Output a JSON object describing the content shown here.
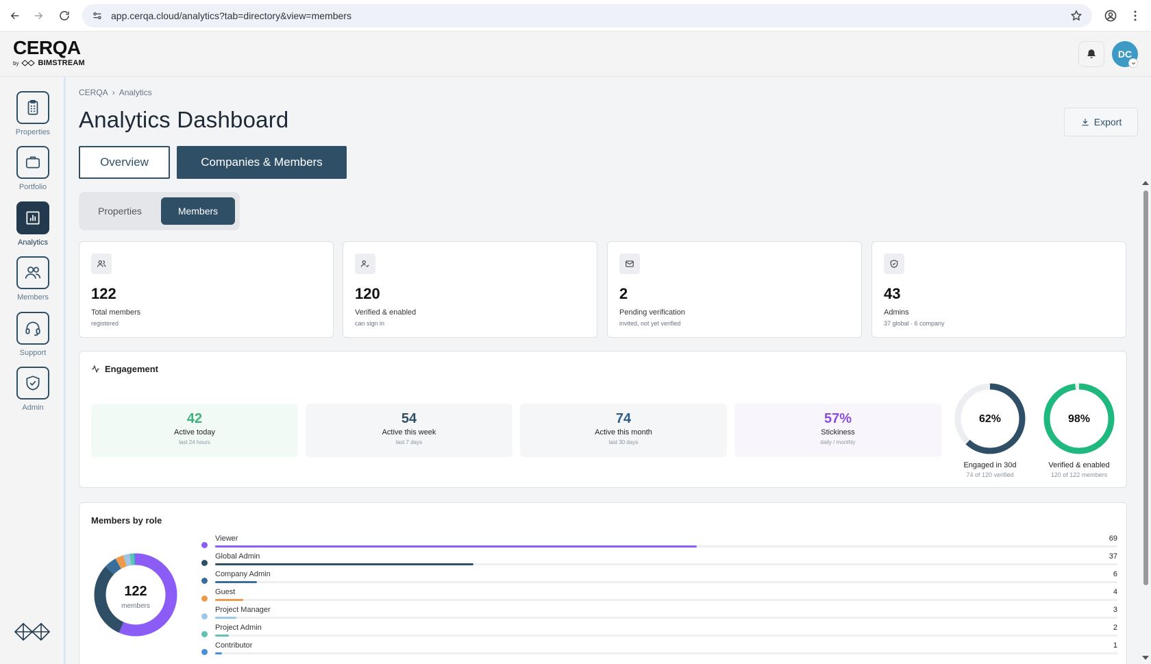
{
  "browser": {
    "url": "app.cerqa.cloud/analytics?tab=directory&view=members"
  },
  "header": {
    "logo": "CERQA",
    "logo_by": "by",
    "logo_sub": "BIMSTREAM",
    "avatar_initials": "DC"
  },
  "sidebar": {
    "items": [
      {
        "label": "Properties",
        "icon": "clipboard-icon"
      },
      {
        "label": "Portfolio",
        "icon": "briefcase-icon"
      },
      {
        "label": "Analytics",
        "icon": "bar-chart-icon",
        "active": true
      },
      {
        "label": "Members",
        "icon": "users-icon"
      },
      {
        "label": "Support",
        "icon": "headset-icon"
      },
      {
        "label": "Admin",
        "icon": "shield-check-icon"
      }
    ]
  },
  "breadcrumb": {
    "root": "CERQA",
    "separator": "›",
    "current": "Analytics"
  },
  "page": {
    "title": "Analytics Dashboard",
    "export_label": "Export"
  },
  "tabs": {
    "overview": "Overview",
    "companies_members": "Companies & Members"
  },
  "subtabs": {
    "properties": "Properties",
    "members": "Members"
  },
  "stats": [
    {
      "value": "122",
      "label": "Total members",
      "sub": "registered",
      "icon": "users-icon"
    },
    {
      "value": "120",
      "label": "Verified & enabled",
      "sub": "can sign in",
      "icon": "user-check-icon"
    },
    {
      "value": "2",
      "label": "Pending verification",
      "sub": "invited, not yet verified",
      "icon": "mail-icon"
    },
    {
      "value": "43",
      "label": "Admins",
      "sub": "37 global · 6 company",
      "icon": "shield-icon"
    }
  ],
  "engagement": {
    "title": "Engagement",
    "boxes": [
      {
        "value": "42",
        "label": "Active today",
        "sub": "last 24 hours",
        "color": "#3bb27a",
        "bg": "#f2faf6"
      },
      {
        "value": "54",
        "label": "Active this week",
        "sub": "last 7 days",
        "color": "#2f4f67",
        "bg": "#f4f6f8"
      },
      {
        "value": "74",
        "label": "Active this month",
        "sub": "last 30 days",
        "color": "#2f5e85",
        "bg": "#f4f6f8"
      },
      {
        "value": "57%",
        "label": "Stickiness",
        "sub": "daily / monthly",
        "color": "#8a4fd8",
        "bg": "#f8f6fc"
      }
    ],
    "rings": [
      {
        "value": "62%",
        "fraction": 0.62,
        "label": "Engaged in 30d",
        "sub": "74 of 120 verified",
        "color": "#2f4f67"
      },
      {
        "value": "98%",
        "fraction": 0.98,
        "label": "Verified & enabled",
        "sub": "120 of 122 members",
        "color": "#1fb97f"
      }
    ]
  },
  "roles": {
    "title": "Members by role",
    "total": "122",
    "total_label": "members",
    "items": [
      {
        "name": "Viewer",
        "count": 69,
        "count_text": "69",
        "color": "#8b5cf6"
      },
      {
        "name": "Global Admin",
        "count": 37,
        "count_text": "37",
        "color": "#2f4f67"
      },
      {
        "name": "Company Admin",
        "count": 6,
        "count_text": "6",
        "color": "#3a6d9a"
      },
      {
        "name": "Guest",
        "count": 4,
        "count_text": "4",
        "color": "#ee9a4d"
      },
      {
        "name": "Project Manager",
        "count": 3,
        "count_text": "3",
        "color": "#9fc6e6"
      },
      {
        "name": "Project Admin",
        "count": 2,
        "count_text": "2",
        "color": "#5fc2b5"
      },
      {
        "name": "Contributor",
        "count": 1,
        "count_text": "1",
        "color": "#4a90d9"
      }
    ]
  }
}
